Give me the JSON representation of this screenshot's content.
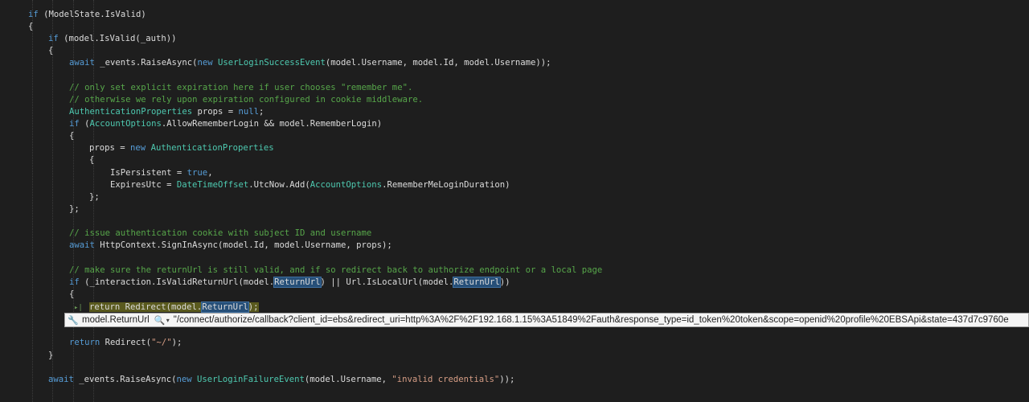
{
  "code": {
    "l1": [
      "if",
      " (ModelState.IsValid)"
    ],
    "l2": "{",
    "l3": [
      "if",
      " (model.IsValid(_auth))"
    ],
    "l4": "{",
    "l5": [
      "await",
      " _events.RaiseAsync(",
      "new",
      " ",
      "UserLoginSuccessEvent",
      "(model.Username, model.Id, model.Username));"
    ],
    "l6": "// only set explicit expiration here if user chooses \"remember me\".",
    "l7": "// otherwise we rely upon expiration configured in cookie middleware.",
    "l8": [
      "AuthenticationProperties",
      " props = ",
      "null",
      ";"
    ],
    "l9": [
      "if",
      " (",
      "AccountOptions",
      ".AllowRememberLogin && model.RememberLogin)"
    ],
    "l10": "{",
    "l11": [
      "props = ",
      "new",
      " ",
      "AuthenticationProperties"
    ],
    "l12": "{",
    "l13": [
      "IsPersistent = ",
      "true",
      ","
    ],
    "l14": [
      "ExpiresUtc = ",
      "DateTimeOffset",
      ".UtcNow.Add(",
      "AccountOptions",
      ".RememberMeLoginDuration)"
    ],
    "l15": "};",
    "l16": "};",
    "l17": "// issue authentication cookie with subject ID and username",
    "l18": [
      "await",
      " HttpContext.SignInAsync(model.Id, model.Username, props);"
    ],
    "l19": "// make sure the returnUrl is still valid, and if so redirect back to authorize endpoint or a local page",
    "l20": [
      "if",
      " (_interaction.IsValidReturnUrl(model.",
      "ReturnUrl",
      ") || Url.IsLocalUrl(model.",
      "ReturnUrl",
      "))"
    ],
    "l21": "{",
    "l22": [
      "return Redirect(model.",
      "ReturnUrl",
      ");"
    ],
    "l23": [
      "return",
      " Redirect(",
      "\"~/\"",
      ");"
    ],
    "l24": "}",
    "l25": [
      "await",
      " _events.RaiseAsync(",
      "new",
      " ",
      "UserLoginFailureEvent",
      "(model.Username, ",
      "\"invalid credentials\"",
      "));"
    ]
  },
  "datatip": {
    "name": "model.ReturnUrl",
    "value": "\"/connect/authorize/callback?client_id=ebs&redirect_uri=http%3A%2F%2F192.168.1.15%3A51849%2Fauth&response_type=id_token%20token&scope=openid%20profile%20EBSApi&state=437d7c9760e",
    "icon_name": "wrench-icon",
    "search_icon": "magnifier-icon"
  },
  "colors": {
    "background": "#1e1e1e",
    "keyword": "#569cd6",
    "type": "#4ec9b0",
    "comment": "#57a64a",
    "string": "#d69d85",
    "reference_highlight": "#264f78"
  }
}
